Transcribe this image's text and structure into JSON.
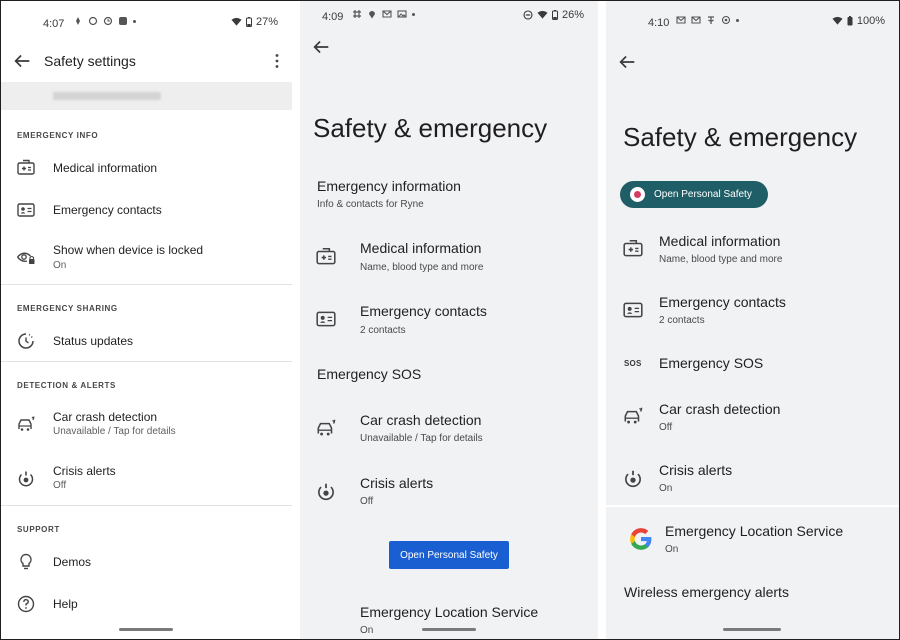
{
  "screen1": {
    "status": {
      "time": "4:07",
      "battery": "27%"
    },
    "title": "Safety settings",
    "sections": {
      "emergency_info": "EMERGENCY INFO",
      "emergency_sharing": "EMERGENCY SHARING",
      "detection_alerts": "DETECTION & ALERTS",
      "support": "SUPPORT"
    },
    "items": {
      "medical": {
        "title": "Medical information"
      },
      "contacts": {
        "title": "Emergency contacts"
      },
      "locked": {
        "title": "Show when device is locked",
        "subtitle": "On"
      },
      "status_updates": {
        "title": "Status updates"
      },
      "car_crash": {
        "title": "Car crash detection",
        "subtitle": "Unavailable / Tap for details"
      },
      "crisis": {
        "title": "Crisis alerts",
        "subtitle": "Off"
      },
      "demos": {
        "title": "Demos"
      },
      "help": {
        "title": "Help"
      }
    }
  },
  "screen2": {
    "status": {
      "time": "4:09",
      "battery": "26%"
    },
    "title": "Safety & emergency",
    "emergency_information": {
      "title": "Emergency information",
      "subtitle": "Info & contacts for Ryne"
    },
    "items": {
      "medical": {
        "title": "Medical information",
        "subtitle": "Name, blood type and more"
      },
      "contacts": {
        "title": "Emergency contacts",
        "subtitle": "2 contacts"
      },
      "car_crash": {
        "title": "Car crash detection",
        "subtitle": "Unavailable / Tap for details"
      },
      "crisis": {
        "title": "Crisis alerts",
        "subtitle": "Off"
      },
      "els": {
        "title": "Emergency Location Service",
        "subtitle": "On"
      }
    },
    "emergency_sos": "Emergency SOS",
    "open_button": "Open Personal Safety"
  },
  "screen3": {
    "status": {
      "time": "4:10",
      "battery": "100%"
    },
    "title": "Safety & emergency",
    "open_button": "Open Personal Safety",
    "items": {
      "medical": {
        "title": "Medical information",
        "subtitle": "Name, blood type and more"
      },
      "contacts": {
        "title": "Emergency contacts",
        "subtitle": "2 contacts"
      },
      "sos": {
        "title": "Emergency SOS",
        "icon_text": "SOS"
      },
      "car_crash": {
        "title": "Car crash detection",
        "subtitle": "Off"
      },
      "crisis": {
        "title": "Crisis alerts",
        "subtitle": "On"
      },
      "els": {
        "title": "Emergency Location Service",
        "subtitle": "On"
      },
      "wea": {
        "title": "Wireless emergency alerts"
      }
    }
  },
  "colors": {
    "personal_safety_pill": "#1f5e67",
    "primary_button": "#1a5fd1",
    "panel_bg": "#f1f2f4"
  },
  "icons": [
    "back-arrow-icon",
    "more-vert-icon",
    "medical-id-icon",
    "contact-card-icon",
    "eye-lock-icon",
    "status-clock-icon",
    "car-crash-icon",
    "crisis-alert-icon",
    "lightbulb-icon",
    "help-circle-icon",
    "google-g-icon",
    "wifi-icon",
    "battery-icon"
  ]
}
